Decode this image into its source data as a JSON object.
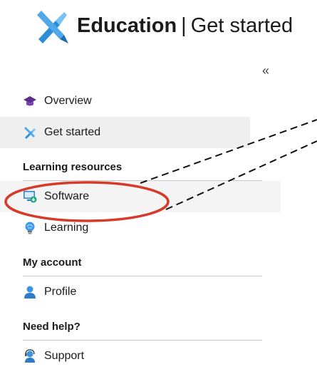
{
  "header": {
    "brand": "Education",
    "separator": "|",
    "page": "Get started",
    "logo_icon": "education-logo-icon"
  },
  "collapse_label": "«",
  "nav": {
    "top_items": [
      {
        "label": "Overview",
        "icon": "graduation-cap-icon"
      },
      {
        "label": "Get started",
        "icon": "tools-icon"
      }
    ],
    "groups": [
      {
        "title": "Learning resources",
        "items": [
          {
            "label": "Software",
            "icon": "software-download-icon"
          },
          {
            "label": "Learning",
            "icon": "lightbulb-icon"
          }
        ]
      },
      {
        "title": "My account",
        "items": [
          {
            "label": "Profile",
            "icon": "user-icon"
          }
        ]
      },
      {
        "title": "Need help?",
        "items": [
          {
            "label": "Support",
            "icon": "support-agent-icon"
          }
        ]
      }
    ]
  },
  "annotation": {
    "highlight_color": "#d63b2a",
    "callout_color": "#111111"
  }
}
